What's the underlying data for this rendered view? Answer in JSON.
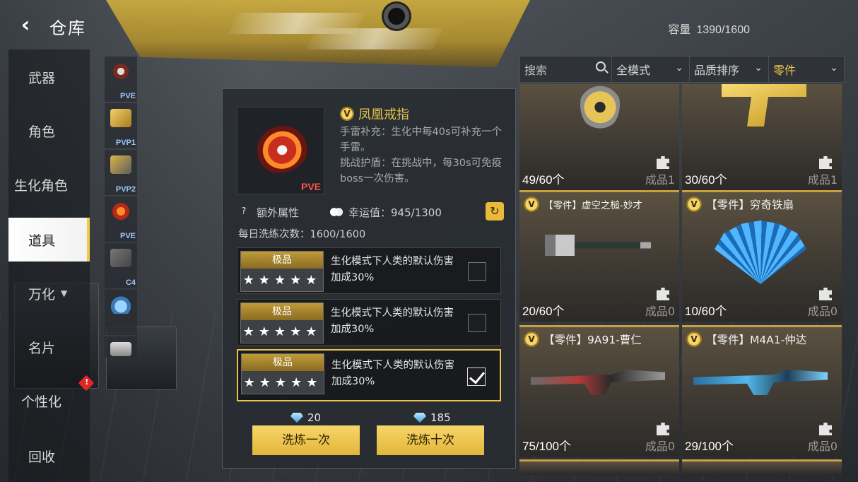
{
  "header": {
    "back_icon": "back-arrow-icon",
    "title": "仓库",
    "capacity_label": "容量",
    "capacity_value": "1390/1600"
  },
  "sidebar": {
    "items": [
      {
        "label": "武器"
      },
      {
        "label": "角色"
      },
      {
        "label": "生化角色"
      },
      {
        "label": "道具",
        "active": true
      },
      {
        "label": "万化",
        "has_dropdown": true
      },
      {
        "label": "名片"
      },
      {
        "label": "个性化"
      },
      {
        "label": "回收"
      }
    ]
  },
  "slots": [
    {
      "label": "PVE"
    },
    {
      "label": "PVP1"
    },
    {
      "label": "PVP2"
    },
    {
      "label": "PVE"
    },
    {
      "label": "C4"
    },
    {
      "label": ""
    },
    {
      "label": ""
    }
  ],
  "detail": {
    "thumb_tag": "PVE",
    "item_name": "凤凰戒指",
    "description": [
      "手雷补充：生化中每40s可补充一个手雷。",
      "挑战护盾：在挑战中，每30s可免疫boss一次伤害。"
    ],
    "extra_attr_label": "额外属性",
    "luck_label": "幸运值：945/1300",
    "daily_label": "每日洗练次数：1600/1600",
    "refine_rows": [
      {
        "grade": "极品",
        "stars": "★★★★★",
        "text": "生化模式下人类的默认伤害加成30%",
        "checked": false
      },
      {
        "grade": "极品",
        "stars": "★★★★★",
        "text": "生化模式下人类的默认伤害加成30%",
        "checked": false
      },
      {
        "grade": "极品",
        "stars": "★★★★★",
        "text": "生化模式下人类的默认伤害加成30%",
        "checked": true
      }
    ],
    "cost_once": "20",
    "cost_ten": "185",
    "refine_once_label": "洗炼一次",
    "refine_ten_label": "洗炼十次"
  },
  "inventory": {
    "search_placeholder": "搜索",
    "mode_label": "全模式",
    "sort_label": "品质排序",
    "type_label": "零件",
    "cards": [
      {
        "title": "",
        "count": "49/60个",
        "product": "成品1"
      },
      {
        "title": "",
        "count": "30/60个",
        "product": "成品1"
      },
      {
        "title": "【零件】虚空之槌-妙才",
        "count": "20/60个",
        "product": "成品0"
      },
      {
        "title": "【零件】穷奇铁扇",
        "count": "10/60个",
        "product": "成品0"
      },
      {
        "title": "【零件】9A91-曹仁",
        "count": "75/100个",
        "product": "成品0"
      },
      {
        "title": "【零件】M4A1-仲达",
        "count": "29/100个",
        "product": "成品0"
      }
    ]
  },
  "colors": {
    "accent_gold": "#e8c24a",
    "legendary_name": "#e7c24a",
    "pve_red": "#ff5252"
  }
}
